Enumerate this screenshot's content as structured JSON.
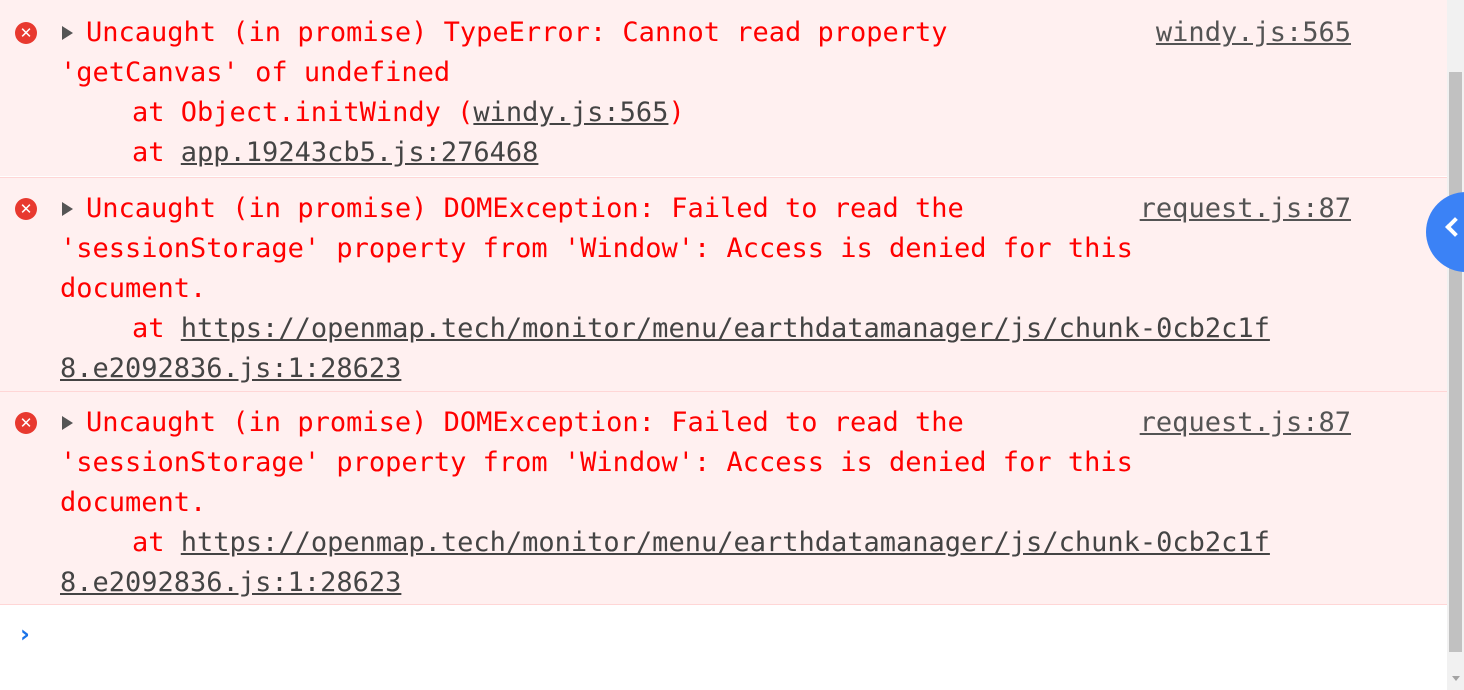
{
  "messages": [
    {
      "source": "windy.js:565",
      "header": "Uncaught (in promise) TypeError: Cannot read property",
      "lines": [
        "'getCanvas' of undefined"
      ],
      "stack": [
        {
          "prefix": "at Object.initWindy (",
          "link": "windy.js:565",
          "suffix": ")"
        },
        {
          "prefix": "at ",
          "link": "app.19243cb5.js:276468",
          "suffix": ""
        }
      ]
    },
    {
      "source": "request.js:87",
      "header": "Uncaught (in promise) DOMException: Failed to read the",
      "lines": [
        "'sessionStorage' property from 'Window': Access is denied for this",
        "document."
      ],
      "stack_prefix": "at ",
      "stack_link_line1": "https://openmap.tech/monitor/menu/earthdatamanager/js/chunk-0cb2c1f",
      "stack_link_line2": "8.e2092836.js:1:28623"
    },
    {
      "source": "request.js:87",
      "header": "Uncaught (in promise) DOMException: Failed to read the",
      "lines": [
        "'sessionStorage' property from 'Window': Access is denied for this",
        "document."
      ],
      "stack_prefix": "at ",
      "stack_link_line1": "https://openmap.tech/monitor/menu/earthdatamanager/js/chunk-0cb2c1f",
      "stack_link_line2": "8.e2092836.js:1:28623"
    }
  ],
  "prompt": {
    "symbol": "›",
    "value": ""
  },
  "icons": {
    "error": "error-x-icon",
    "expand": "expand-triangle-icon",
    "prompt": "chevron-right-icon"
  },
  "colors": {
    "error_text": "#ff0000",
    "error_bg": "#fff0f0",
    "link": "#545454",
    "prompt": "#1a73e8"
  }
}
